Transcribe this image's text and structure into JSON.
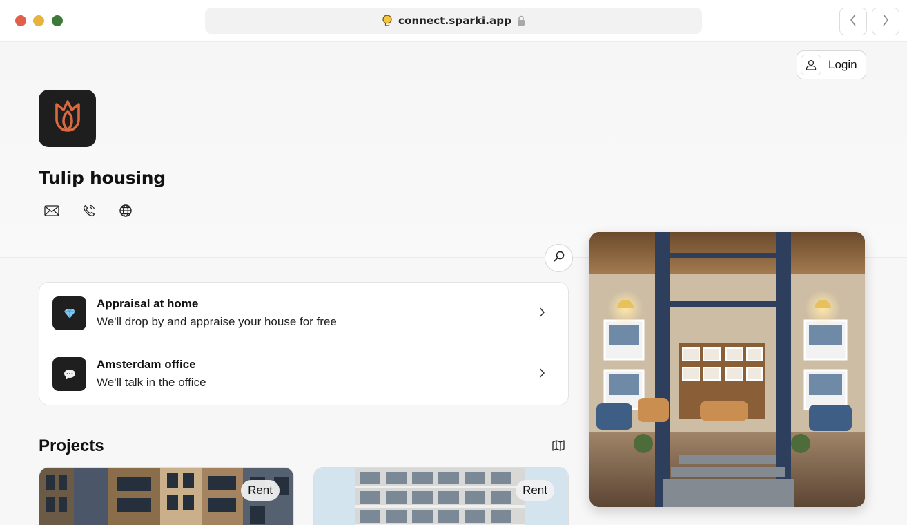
{
  "browser": {
    "url": "connect.sparki.app",
    "site_icon": "lightbulb-icon",
    "lock_icon": "lock-icon",
    "back_icon": "chevron-left-icon",
    "forward_icon": "chevron-right-icon"
  },
  "header": {
    "login_label": "Login",
    "login_icon": "user-icon"
  },
  "company": {
    "name": "Tulip housing",
    "logo_icon": "tulip-icon",
    "logo_color": "#d9693f",
    "contacts": [
      {
        "icon": "mail-icon"
      },
      {
        "icon": "phone-icon"
      },
      {
        "icon": "globe-icon"
      }
    ]
  },
  "services": [
    {
      "icon": "diamond-icon",
      "title": "Appraisal at home",
      "subtitle": "We'll drop by and appraise your house for free"
    },
    {
      "icon": "chat-bubble-icon",
      "title": "Amsterdam office",
      "subtitle": "We'll talk in the office"
    }
  ],
  "projects": {
    "title": "Projects",
    "map_icon": "map-icon",
    "items": [
      {
        "badge": "Rent"
      },
      {
        "badge": "Rent"
      }
    ]
  },
  "colors": {
    "accent": "#d9693f",
    "dark_tile": "#1f1f1f",
    "background": "#f7f7f7"
  }
}
